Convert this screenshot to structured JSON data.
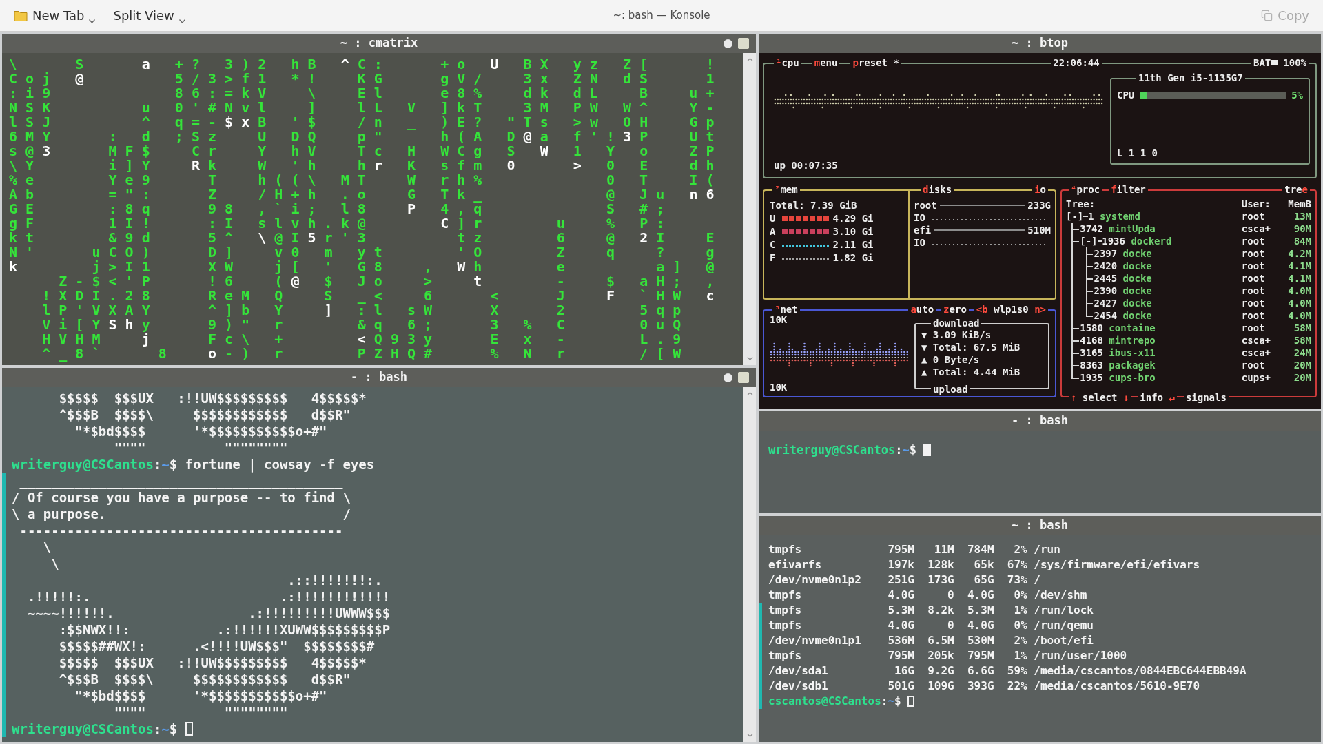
{
  "window": {
    "title": "~: bash — Konsole"
  },
  "toolbar": {
    "left": [
      {
        "kind": "new-tab",
        "label": "New Tab",
        "menu": true,
        "disabled": false
      },
      {
        "kind": "split-view",
        "label": "Split View",
        "menu": true,
        "disabled": false
      }
    ],
    "right": [
      {
        "kind": "copy",
        "label": "Copy",
        "menu": false,
        "disabled": true
      }
    ]
  },
  "cmatrix": {
    "title": "~ : cmatrix",
    "header_icons": true,
    "scrollbar": true,
    "rows": [
      "\\       S       **a**   + ?   3 ) 2   h B   **^** C :       + o   **U**   B X   y z   Z [       !",
      "C o j   **@**           5 / 3 > f 1   * !     K G       g V /     3 x   Z N   d S       1",
      ": i 9               8 6 : = k V     \\     E l       e 8 %     d k   d L     B     u +",
      "N S K           u   0 ' # N v l     ]     l L   V   ] k T     3 M   P W   W ^     Y -",
      "l S J           ^   q = - **$** **x** B   ' $     / n   _   ) E ?   \" T s   > w   O H     G p",
      "6 M Y       :   d   ; S z     U   D Q     p \"       h ( A   D **@** a   f ' ! **3** P     U t",
      "s @ **3**       M F $     C r     Y   h V     T c   H   W C g   S   **W**   1   Y   o     Z P",
      "\\ Y         i ] Y     **R** k     W   ' h     h **r**   K   s f m   **0**       **>**   0   E     d h",
      "% e         Y e 9       T     h ( ( \\   M T     W   r h %               0   T     I (",
      "A b         = \" :       Z     / H + h   . o     G   T k _               @   J u   **n** **6**",
      "G E         : 8 q       9 8   , ` i ;   l 8     **P**   4 , q               S   # ;",
      "g F         1 I !       : I   s l v h . k @         **C** ] r         u     %   P :",
      "k t         & 9 d       5 ^   **\\** @ I **5** r ' 3           t z         6     @   **2** I     E",
      "N '       u C O )       D ]     v 0   m   y t         ' O         Z     q     ?     g",
      "**k**         j > I 1       X W     j [   '   G 8     ,   **W** h         e           a ]   @",
      "      Z - $ < ' P       ! 6     ( **@**   $   J o     >     **t**         -     $   a H ;   ,",
      "    ! X D I . 2 8       R e M   Q     S   _ <     6       <       J     **F**   ` H W   **c**",
      "    l P ' V X A Y       ^ ] b   Y     **]**   : l   s W       X       2         5 q p",
      "    V i [ Y **S** **h** y       9 ) \"   r         & q   6 ;       3   %   C         0 u Q",
      "    H V H M     **j**       F c \\   +         **<** Q 9 3 y       E   x   -         L . 9",
      "    ^ _ 8 `       8     **o** - )   r         P Z H Q #       %   N   r         / [ W"
    ]
  },
  "bash_left": {
    "title": "- : bash",
    "header_icons": true,
    "scrollbar": true,
    "focused": false,
    "lines": [
      {
        "kind": "output",
        "text": "      $$$$$  $$$UX   :!!UW$$$$$$$$$   4$$$$$*",
        "marked": false
      },
      {
        "kind": "output",
        "text": "      ^$$$B  $$$$\\     $$$$$$$$$$$$   d$$R\"",
        "marked": false
      },
      {
        "kind": "output",
        "text": "        \"*$bd$$$$      '*$$$$$$$$$$$o+#\"",
        "marked": false
      },
      {
        "kind": "output",
        "text": "             \"\"\"\"          \"\"\"\"\"\"\"\"",
        "marked": false
      },
      {
        "kind": "prompt",
        "user": "writerguy@CSCantos",
        "sep": ":",
        "path": "~",
        "symbol": "$",
        "command": "fortune | cowsay -f eyes",
        "cursor": false,
        "marked": false
      },
      {
        "kind": "output",
        "text": " _________________________________________",
        "marked": true
      },
      {
        "kind": "output",
        "text": "/ Of course you have a purpose -- to find \\",
        "marked": true
      },
      {
        "kind": "output",
        "text": "\\ a purpose.                              /",
        "marked": true
      },
      {
        "kind": "output",
        "text": " -----------------------------------------",
        "marked": true
      },
      {
        "kind": "output",
        "text": "    \\",
        "marked": true
      },
      {
        "kind": "output",
        "text": "     \\",
        "marked": true
      },
      {
        "kind": "output",
        "text": "                                   .::!!!!!!!:.",
        "marked": true
      },
      {
        "kind": "output",
        "text": "  .!!!!!:.                        .:!!!!!!!!!!!!",
        "marked": true
      },
      {
        "kind": "output",
        "text": "  ~~~~!!!!!!.                 .:!!!!!!!!!UWWW$$$",
        "marked": true
      },
      {
        "kind": "output",
        "text": "      :$$NWX!!:           .:!!!!!!XUWW$$$$$$$$$P",
        "marked": true
      },
      {
        "kind": "output",
        "text": "      $$$$$##WX!:      .<!!!!UW$$$\"  $$$$$$$$#",
        "marked": true
      },
      {
        "kind": "output",
        "text": "      $$$$$  $$$UX   :!!UW$$$$$$$$$   4$$$$$*",
        "marked": true
      },
      {
        "kind": "output",
        "text": "      ^$$$B  $$$$\\     $$$$$$$$$$$$   d$$R\"",
        "marked": true
      },
      {
        "kind": "output",
        "text": "        \"*$bd$$$$      '*$$$$$$$$$$$o+#\"",
        "marked": true
      },
      {
        "kind": "output",
        "text": "             \"\"\"\"          \"\"\"\"\"\"\"\"",
        "marked": true
      },
      {
        "kind": "prompt",
        "user": "writerguy@CSCantos",
        "sep": ":",
        "path": "~",
        "symbol": "$",
        "cursor": true,
        "marked": true
      }
    ]
  },
  "btop": {
    "title": "~ : btop",
    "cpu": {
      "titles": [
        {
          "parts": [
            {
              "text": "¹",
              "kind": "key"
            },
            {
              "text": "cpu",
              "kind": "text"
            }
          ]
        },
        {
          "parts": [
            {
              "text": "m",
              "kind": "key"
            },
            {
              "text": "enu",
              "kind": "text"
            }
          ]
        },
        {
          "parts": [
            {
              "text": "p",
              "kind": "key"
            },
            {
              "text": "reset *",
              "kind": "text"
            }
          ]
        }
      ],
      "clock": "22:06:44",
      "battery": {
        "label": "BAT",
        "reading": "100%"
      },
      "model": "11th Gen i5-1135G7",
      "meter_label": "CPU",
      "level": 0.05,
      "reading": "5%",
      "load": "L 1 1 0",
      "uptime": "up 00:07:35"
    },
    "mem": {
      "titles": [
        {
          "parts": [
            {
              "text": "²",
              "kind": "key"
            },
            {
              "text": "mem",
              "kind": "text"
            }
          ]
        }
      ],
      "total": "Total: 7.39 GiB",
      "rows": [
        {
          "label": "U",
          "kind": "bar",
          "color": "#e8453c",
          "value": "4.29 Gi"
        },
        {
          "label": "A",
          "kind": "bar",
          "color": "#c9405c",
          "value": "3.10 Gi"
        },
        {
          "label": "C",
          "kind": "dots",
          "color": "#42c6dc",
          "value": "2.11 Gi"
        },
        {
          "label": "F",
          "kind": "dots",
          "color": "#a3a3a3",
          "value": "1.82 Gi"
        }
      ]
    },
    "disks": {
      "titles": [
        {
          "parts": [
            {
              "text": "d",
              "kind": "key"
            },
            {
              "text": "isks",
              "kind": "text"
            }
          ]
        },
        {
          "parts": [
            {
              "text": "i",
              "kind": "key"
            },
            {
              "text": "o",
              "kind": "text"
            }
          ]
        }
      ],
      "rows": [
        {
          "kind": "disk",
          "name": "root",
          "size": "233G"
        },
        {
          "kind": "io",
          "name": "IO"
        },
        {
          "kind": "disk",
          "name": "efi",
          "size": "510M"
        },
        {
          "kind": "io",
          "name": "IO"
        }
      ]
    },
    "net": {
      "titles": [
        {
          "parts": [
            {
              "text": "³",
              "kind": "key"
            },
            {
              "text": "net",
              "kind": "text"
            }
          ]
        },
        {
          "parts": [
            {
              "text": "a",
              "kind": "key"
            },
            {
              "text": "uto",
              "kind": "text"
            }
          ]
        },
        {
          "parts": [
            {
              "text": "z",
              "kind": "key"
            },
            {
              "text": "ero",
              "kind": "text"
            }
          ]
        },
        {
          "parts": [
            {
              "text": "<b",
              "kind": "key"
            },
            {
              "text": " wlp1s0 ",
              "kind": "text"
            },
            {
              "text": "n>",
              "kind": "key"
            }
          ]
        }
      ],
      "scale_top": "10K",
      "scale_bottom": "10K",
      "download_title": "download",
      "upload_title": "upload",
      "stats": [
        "▼ 3.09 KiB/s",
        "▼ Total: 67.5 MiB",
        "▲ 0 Byte/s",
        "▲ Total: 4.44 MiB"
      ]
    },
    "proc": {
      "titles": [
        {
          "parts": [
            {
              "text": "⁴",
              "kind": "key"
            },
            {
              "text": "proc",
              "kind": "text"
            }
          ]
        },
        {
          "parts": [
            {
              "text": "f",
              "kind": "key"
            },
            {
              "text": "ilter",
              "kind": "text"
            }
          ]
        },
        {
          "parts": [
            {
              "text": "tre",
              "kind": "text"
            },
            {
              "text": "e",
              "kind": "key"
            }
          ]
        }
      ],
      "columns": [
        "Tree:",
        "User:",
        "MemB"
      ],
      "tree": [
        {
          "toggle": "[-]",
          "pid": "1",
          "name": "systemd",
          "user": "root",
          "mem": "13M",
          "children": [
            {
              "pid": "3742",
              "name": "mintUpda",
              "user": "csca+",
              "mem": "90M"
            },
            {
              "toggle": "[-]",
              "pid": "1936",
              "name": "dockerd",
              "user": "root",
              "mem": "84M",
              "children": [
                {
                  "pid": "2397",
                  "name": "docke",
                  "user": "root",
                  "mem": "4.2M"
                },
                {
                  "pid": "2420",
                  "name": "docke",
                  "user": "root",
                  "mem": "4.1M"
                },
                {
                  "pid": "2445",
                  "name": "docke",
                  "user": "root",
                  "mem": "4.1M"
                },
                {
                  "pid": "2390",
                  "name": "docke",
                  "user": "root",
                  "mem": "4.0M"
                },
                {
                  "pid": "2427",
                  "name": "docke",
                  "user": "root",
                  "mem": "4.0M"
                },
                {
                  "pid": "2454",
                  "name": "docke",
                  "user": "root",
                  "mem": "4.0M"
                }
              ]
            },
            {
              "pid": "1580",
              "name": "containe",
              "user": "root",
              "mem": "58M"
            },
            {
              "pid": "4168",
              "name": "mintrepo",
              "user": "csca+",
              "mem": "58M"
            },
            {
              "pid": "3165",
              "name": "ibus-x11",
              "user": "csca+",
              "mem": "24M"
            },
            {
              "pid": "8363",
              "name": "packagek",
              "user": "root",
              "mem": "20M"
            },
            {
              "pid": "1935",
              "name": "cups-bro",
              "user": "cups+",
              "mem": "20M"
            }
          ]
        }
      ],
      "footer": [
        {
          "parts": [
            {
              "text": "↑",
              "kind": "key"
            },
            {
              "text": " select ",
              "kind": "text"
            },
            {
              "text": "↓",
              "kind": "key"
            }
          ]
        },
        {
          "parts": [
            {
              "text": "info ",
              "kind": "text"
            },
            {
              "text": "↵",
              "kind": "key"
            }
          ]
        },
        {
          "parts": [
            {
              "text": "signals",
              "kind": "text"
            }
          ]
        }
      ]
    }
  },
  "bash_middle": {
    "title": "- : bash",
    "focused": true,
    "lines": [
      {
        "kind": "prompt",
        "user": "writerguy@CSCantos",
        "sep": ":",
        "path": "~",
        "symbol": "$",
        "cursor": true,
        "marked": false
      }
    ]
  },
  "bash_bottom": {
    "title": "~ : bash",
    "focused": false,
    "lines": [
      {
        "kind": "df",
        "filesystem": "tmpfs",
        "size": "795M",
        "used": "11M",
        "avail": "784M",
        "use": "2%",
        "mount": "/run",
        "marked": false
      },
      {
        "kind": "df",
        "filesystem": "efivarfs",
        "size": "197k",
        "used": "128k",
        "avail": "65k",
        "use": "67%",
        "mount": "/sys/firmware/efi/efivars",
        "marked": false
      },
      {
        "kind": "df",
        "filesystem": "/dev/nvme0n1p2",
        "size": "251G",
        "used": "173G",
        "avail": "65G",
        "use": "73%",
        "mount": "/",
        "marked": false
      },
      {
        "kind": "df",
        "filesystem": "tmpfs",
        "size": "4.0G",
        "used": "0",
        "avail": "4.0G",
        "use": "0%",
        "mount": "/dev/shm",
        "marked": false
      },
      {
        "kind": "df",
        "filesystem": "tmpfs",
        "size": "5.3M",
        "used": "8.2k",
        "avail": "5.3M",
        "use": "1%",
        "mount": "/run/lock",
        "marked": true
      },
      {
        "kind": "df",
        "filesystem": "tmpfs",
        "size": "4.0G",
        "used": "0",
        "avail": "4.0G",
        "use": "0%",
        "mount": "/run/qemu",
        "marked": true
      },
      {
        "kind": "df",
        "filesystem": "/dev/nvme0n1p1",
        "size": "536M",
        "used": "6.5M",
        "avail": "530M",
        "use": "2%",
        "mount": "/boot/efi",
        "marked": true
      },
      {
        "kind": "df",
        "filesystem": "tmpfs",
        "size": "795M",
        "used": "205k",
        "avail": "795M",
        "use": "1%",
        "mount": "/run/user/1000",
        "marked": true
      },
      {
        "kind": "df",
        "filesystem": "/dev/sda1",
        "size": "16G",
        "used": "9.2G",
        "avail": "6.6G",
        "use": "59%",
        "mount": "/media/cscantos/0844EBC644EBB49A",
        "marked": true
      },
      {
        "kind": "df",
        "filesystem": "/dev/sdb1",
        "size": "501G",
        "used": "109G",
        "avail": "393G",
        "use": "22%",
        "mount": "/media/cscantos/5610-9E70",
        "marked": true
      },
      {
        "kind": "prompt",
        "user": "cscantos@CSCantos",
        "sep": ":",
        "path": "~",
        "symbol": "$",
        "cursor": true,
        "marked": true
      }
    ]
  }
}
